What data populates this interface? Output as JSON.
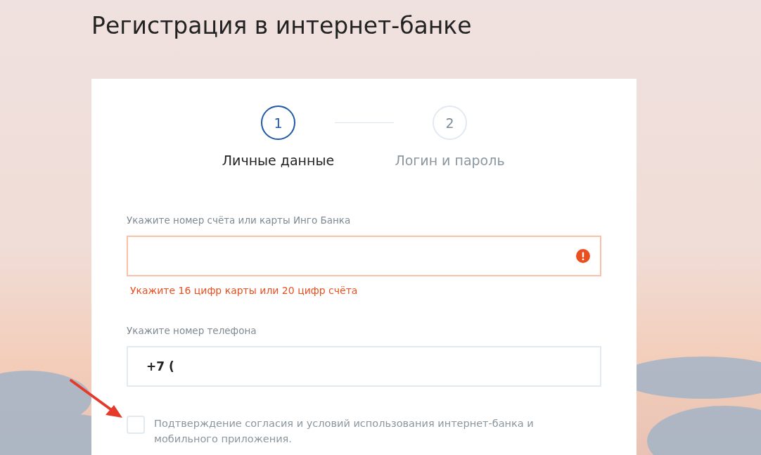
{
  "page": {
    "title": "Регистрация в интернет-банке"
  },
  "steps": [
    {
      "number": "1",
      "label": "Личные данные",
      "selected": true
    },
    {
      "number": "2",
      "label": "Логин и пароль",
      "selected": false
    }
  ],
  "fields": [
    {
      "label": "Укажите номер счёта или карты Инго Банка",
      "invalid": true,
      "error": "Укажите 16 цифр карты или 20 цифр счёта"
    },
    {
      "label": "Укажите номер телефона",
      "value": "+7 (",
      "invalid": false
    }
  ],
  "agreement": {
    "checked": false,
    "text": "Подтверждение согласия и условий использования интернет-банка и мобильного приложения."
  }
}
